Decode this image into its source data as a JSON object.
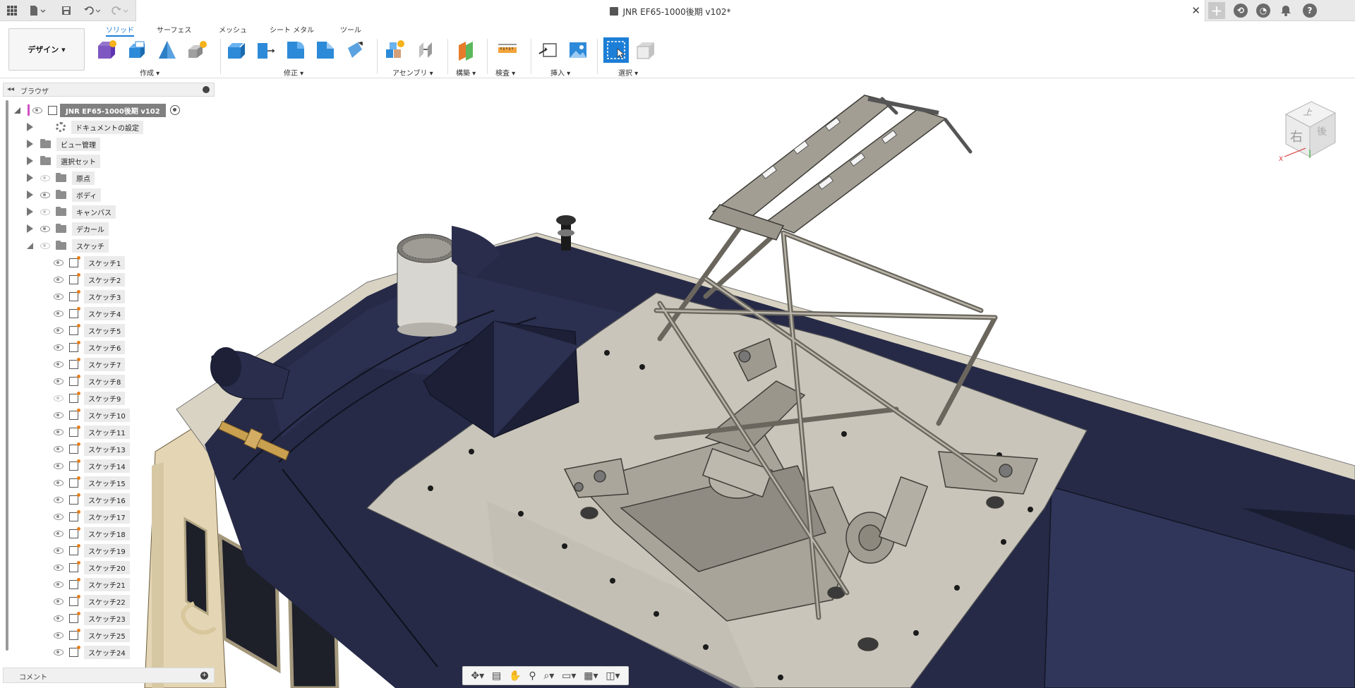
{
  "document": {
    "title": "JNR EF65-1000後期 v102*"
  },
  "ribbon": {
    "workspace": "デザイン",
    "tabs": [
      "ソリッド",
      "サーフェス",
      "メッシュ",
      "シート メタル",
      "ツール"
    ],
    "groups": [
      "作成",
      "修正",
      "アセンブリ",
      "構築",
      "検査",
      "挿入",
      "選択"
    ]
  },
  "browser": {
    "title": "ブラウザ",
    "root": "JNR EF65-1000後期 v102",
    "items": [
      {
        "label": "ドキュメントの設定"
      },
      {
        "label": "ビュー管理"
      },
      {
        "label": "選択セット"
      },
      {
        "label": "原点"
      },
      {
        "label": "ボディ"
      },
      {
        "label": "キャンバス"
      },
      {
        "label": "デカール"
      },
      {
        "label": "スケッチ"
      }
    ],
    "sketches": [
      "スケッチ1",
      "スケッチ2",
      "スケッチ3",
      "スケッチ4",
      "スケッチ5",
      "スケッチ6",
      "スケッチ7",
      "スケッチ8",
      "スケッチ9",
      "スケッチ10",
      "スケッチ11",
      "スケッチ13",
      "スケッチ14",
      "スケッチ15",
      "スケッチ16",
      "スケッチ17",
      "スケッチ18",
      "スケッチ19",
      "スケッチ20",
      "スケッチ21",
      "スケッチ22",
      "スケッチ23",
      "スケッチ25",
      "スケッチ24"
    ]
  },
  "comments": {
    "title": "コメント"
  },
  "viewcube": {
    "top": "上",
    "right": "右",
    "back": "後"
  },
  "colors": {
    "accent": "#1c7ed6",
    "body_navy": "#262a47",
    "plate": "#c6c2b7",
    "cream": "#e4d6b5",
    "metal": "#8e8a80"
  },
  "icons": [
    "app-grid-icon",
    "file-icon",
    "save-icon",
    "undo-icon",
    "redo-icon",
    "new-tab-icon",
    "extensions-icon",
    "job-status-icon",
    "notifications-icon",
    "help-icon"
  ]
}
